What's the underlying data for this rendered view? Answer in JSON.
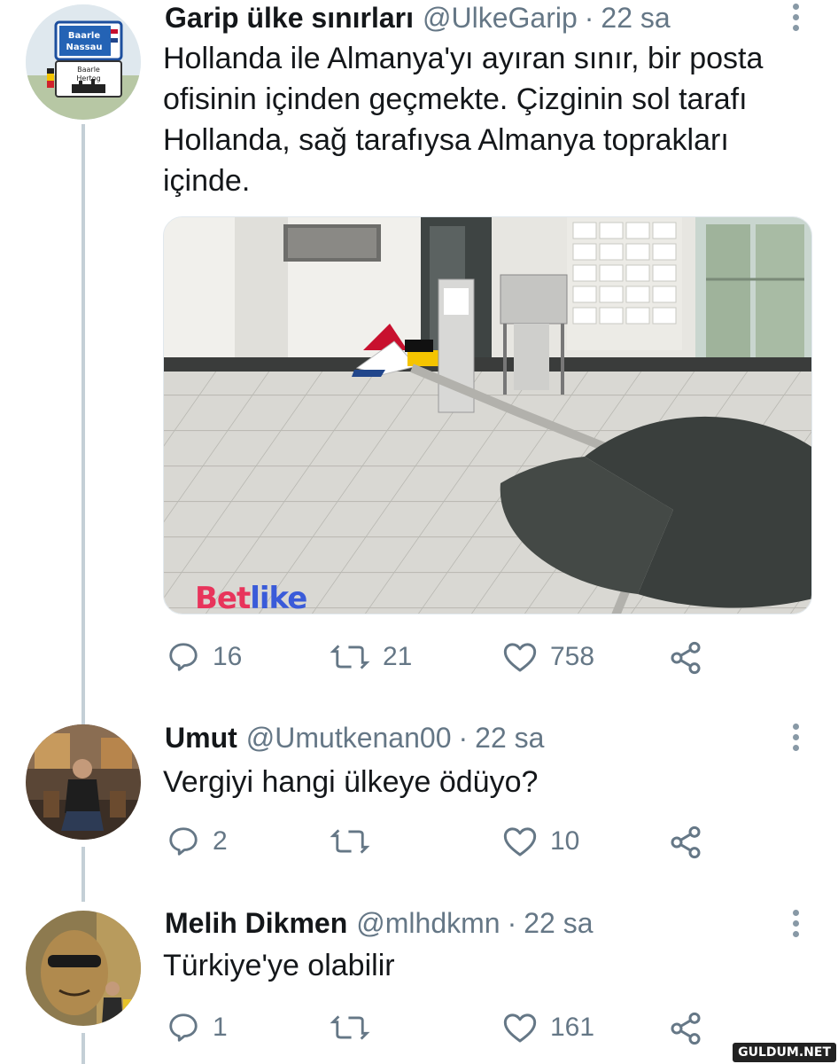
{
  "tweets": [
    {
      "name": "Garip ülke sınırları",
      "handle": "@UlkeGarip",
      "separator": "·",
      "time": "22 sa",
      "text": "Hollanda ile Almanya'yı ayıran sınır, bir posta ofisinin içinden geçmekte. Çizginin sol tarafı Hollanda, sağ tarafıysa Almanya toprakları içinde.",
      "text_lines": [
        "Hollanda ile Almanya'yı ayıran sınır, bir posta",
        "ofisinin içinden geçmekte. Çizginin sol tarafı",
        "Hollanda, sağ tarafıysa Almanya toprakları",
        "içinde."
      ],
      "avatar_sign": {
        "top_line1": "Baarle",
        "top_line2": "Nassau",
        "bottom_line1": "Baarle",
        "bottom_line2": "Hertog"
      },
      "reply_count": "16",
      "retweet_count": "21",
      "like_count": "758"
    },
    {
      "name": "Umut",
      "handle": "@Umutkenan00",
      "separator": "·",
      "time": "22 sa",
      "text": "Vergiyi hangi ülkeye ödüyo?",
      "reply_count": "2",
      "retweet_count": "",
      "like_count": "10"
    },
    {
      "name": "Melih Dikmen",
      "handle": "@mlhdkmn",
      "separator": "·",
      "time": "22 sa",
      "text": "Türkiye'ye olabilir",
      "reply_count": "1",
      "retweet_count": "",
      "like_count": "161"
    }
  ],
  "media": {
    "watermark_part1": "Bet",
    "watermark_part2": "like"
  },
  "site_watermark": "GULDUM.NET",
  "icons": {
    "reply": "reply-icon",
    "retweet": "retweet-icon",
    "like": "heart-icon",
    "share": "share-icon",
    "more": "more-options-icon"
  },
  "colors": {
    "text": "#14171a",
    "secondary": "#657786",
    "thread_line": "#c4cfd6"
  }
}
